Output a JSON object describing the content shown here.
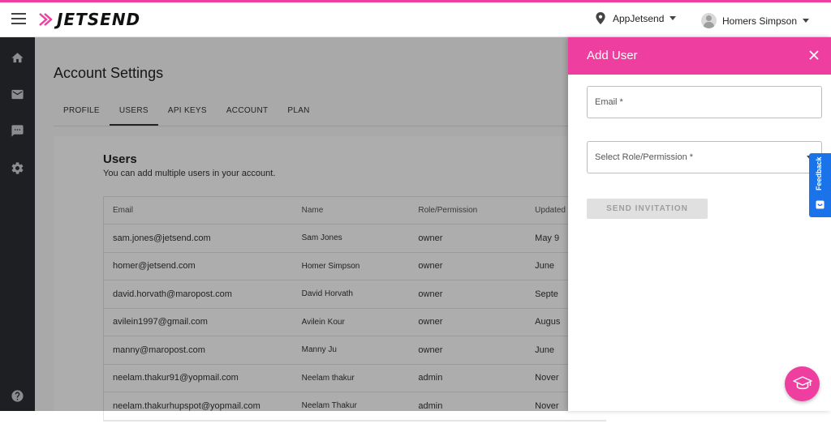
{
  "header": {
    "logo_text": "JETSEND",
    "account_name": "AppJetsend",
    "user_name": "Homers Simpson"
  },
  "sidenav": {
    "items": [
      "home-icon",
      "mail-icon",
      "chat-icon",
      "settings-icon",
      "help-icon"
    ]
  },
  "page": {
    "title": "Account Settings",
    "tabs": [
      {
        "label": "PROFILE",
        "active": false
      },
      {
        "label": "USERS",
        "active": true
      },
      {
        "label": "API KEYS",
        "active": false
      },
      {
        "label": "ACCOUNT",
        "active": false
      },
      {
        "label": "PLAN",
        "active": false
      }
    ]
  },
  "users_card": {
    "title": "Users",
    "subtitle": "You can add multiple users in your account.",
    "columns": [
      "Email",
      "Name",
      "Role/Permission",
      "Updated"
    ],
    "rows": [
      {
        "email": "sam.jones@jetsend.com",
        "name": "Sam Jones",
        "role": "owner",
        "updated": "May 9"
      },
      {
        "email": "homer@jetsend.com",
        "name": "Homer Simpson",
        "role": "owner",
        "updated": "June"
      },
      {
        "email": "david.horvath@maropost.com",
        "name": "David Horvath",
        "role": "owner",
        "updated": "Septe"
      },
      {
        "email": "avilein1997@gmail.com",
        "name": "Avilein Kour",
        "role": "owner",
        "updated": "Augus"
      },
      {
        "email": "manny@maropost.com",
        "name": "Manny Ju",
        "role": "owner",
        "updated": "June"
      },
      {
        "email": "neelam.thakur91@yopmail.com",
        "name": "Neelam thakur",
        "role": "admin",
        "updated": "Nover"
      },
      {
        "email": "neelam.thakurhupspot@yopmail.com",
        "name": "Neelam Thakur",
        "role": "admin",
        "updated": "Nover"
      }
    ]
  },
  "drawer": {
    "title": "Add User",
    "email_label": "Email *",
    "role_label": "Select Role/Permission *",
    "send_button": "SEND INVITATION"
  },
  "feedback": {
    "label": "Feedback"
  },
  "colors": {
    "brand": "#ee3e9f",
    "sidebar": "#2c2e33",
    "feedback": "#1a73e8"
  }
}
